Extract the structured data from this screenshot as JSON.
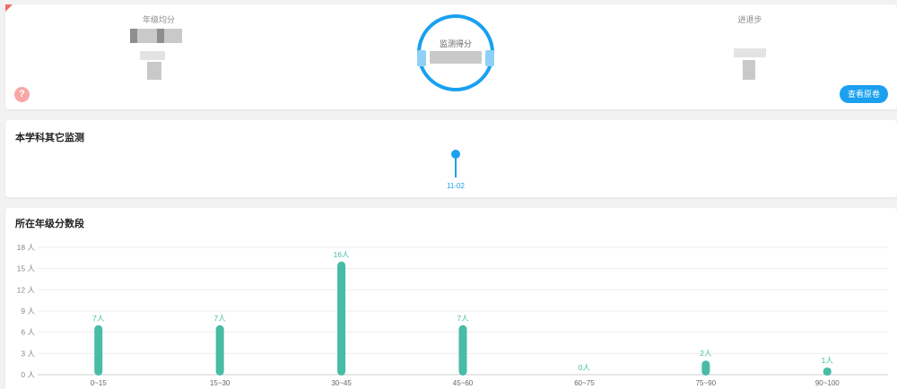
{
  "summary": {
    "grade_average_label": "年级均分",
    "monitor_score_label": "监测得分",
    "progress_label": "进退步",
    "view_paper_label": "查看原卷",
    "help_glyph": "?"
  },
  "other_monitoring": {
    "title": "本学科其它监测",
    "items": [
      {
        "date": "11-02"
      }
    ]
  },
  "distribution": {
    "title": "所在年级分数段"
  },
  "colors": {
    "accent": "#1aa0ef",
    "bar": "#48bca5",
    "help": "#f7a6a6"
  },
  "chart_data": {
    "type": "bar",
    "title": "所在年级分数段",
    "categories": [
      "0~15",
      "15~30",
      "30~45",
      "45~60",
      "60~75",
      "75~90",
      "90~100"
    ],
    "values": [
      7,
      7,
      16,
      7,
      0,
      2,
      1
    ],
    "value_labels": [
      "7人",
      "7人",
      "16人",
      "7人",
      "0人",
      "2人",
      "1人"
    ],
    "yticks": [
      "0 人",
      "3 人",
      "6 人",
      "9 人",
      "12 人",
      "15 人",
      "18 人"
    ],
    "ylim": [
      0,
      18
    ],
    "grid": true,
    "legend": "none"
  }
}
